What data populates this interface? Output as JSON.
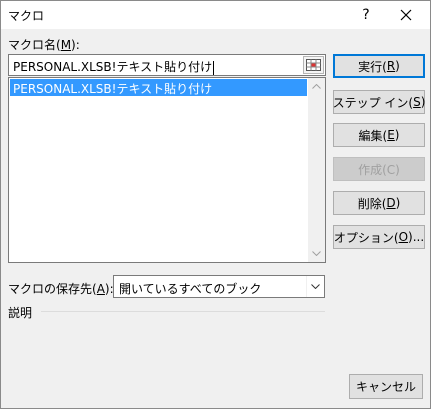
{
  "window": {
    "title": "マクロ",
    "help_label": "?"
  },
  "macro_name": {
    "label_prefix": "マクロ名(",
    "label_key": "M",
    "label_suffix": "):",
    "value": "PERSONAL.XLSB!テキスト貼り付け"
  },
  "macro_list": {
    "items": [
      "PERSONAL.XLSB!テキスト貼り付け"
    ],
    "selected_index": 0
  },
  "buttons": {
    "run": {
      "text": "実行(",
      "key": "R",
      "end": ")"
    },
    "step_into": {
      "text": "ステップ イン(",
      "key": "S",
      "end": ")"
    },
    "edit": {
      "text": "編集(",
      "key": "E",
      "end": ")"
    },
    "create": {
      "text": "作成(C)",
      "enabled": false
    },
    "delete": {
      "text": "削除(",
      "key": "D",
      "end": ")"
    },
    "options": {
      "text": "オプション(",
      "key": "O",
      "end": ")..."
    },
    "cancel": "キャンセル"
  },
  "macros_in": {
    "label_prefix": "マクロの保存先(",
    "label_key": "A",
    "label_suffix": "):",
    "selected": "開いているすべてのブック"
  },
  "description": {
    "label": "説明"
  },
  "colors": {
    "selection": "#3399ff",
    "default_border": "#0078d7"
  }
}
